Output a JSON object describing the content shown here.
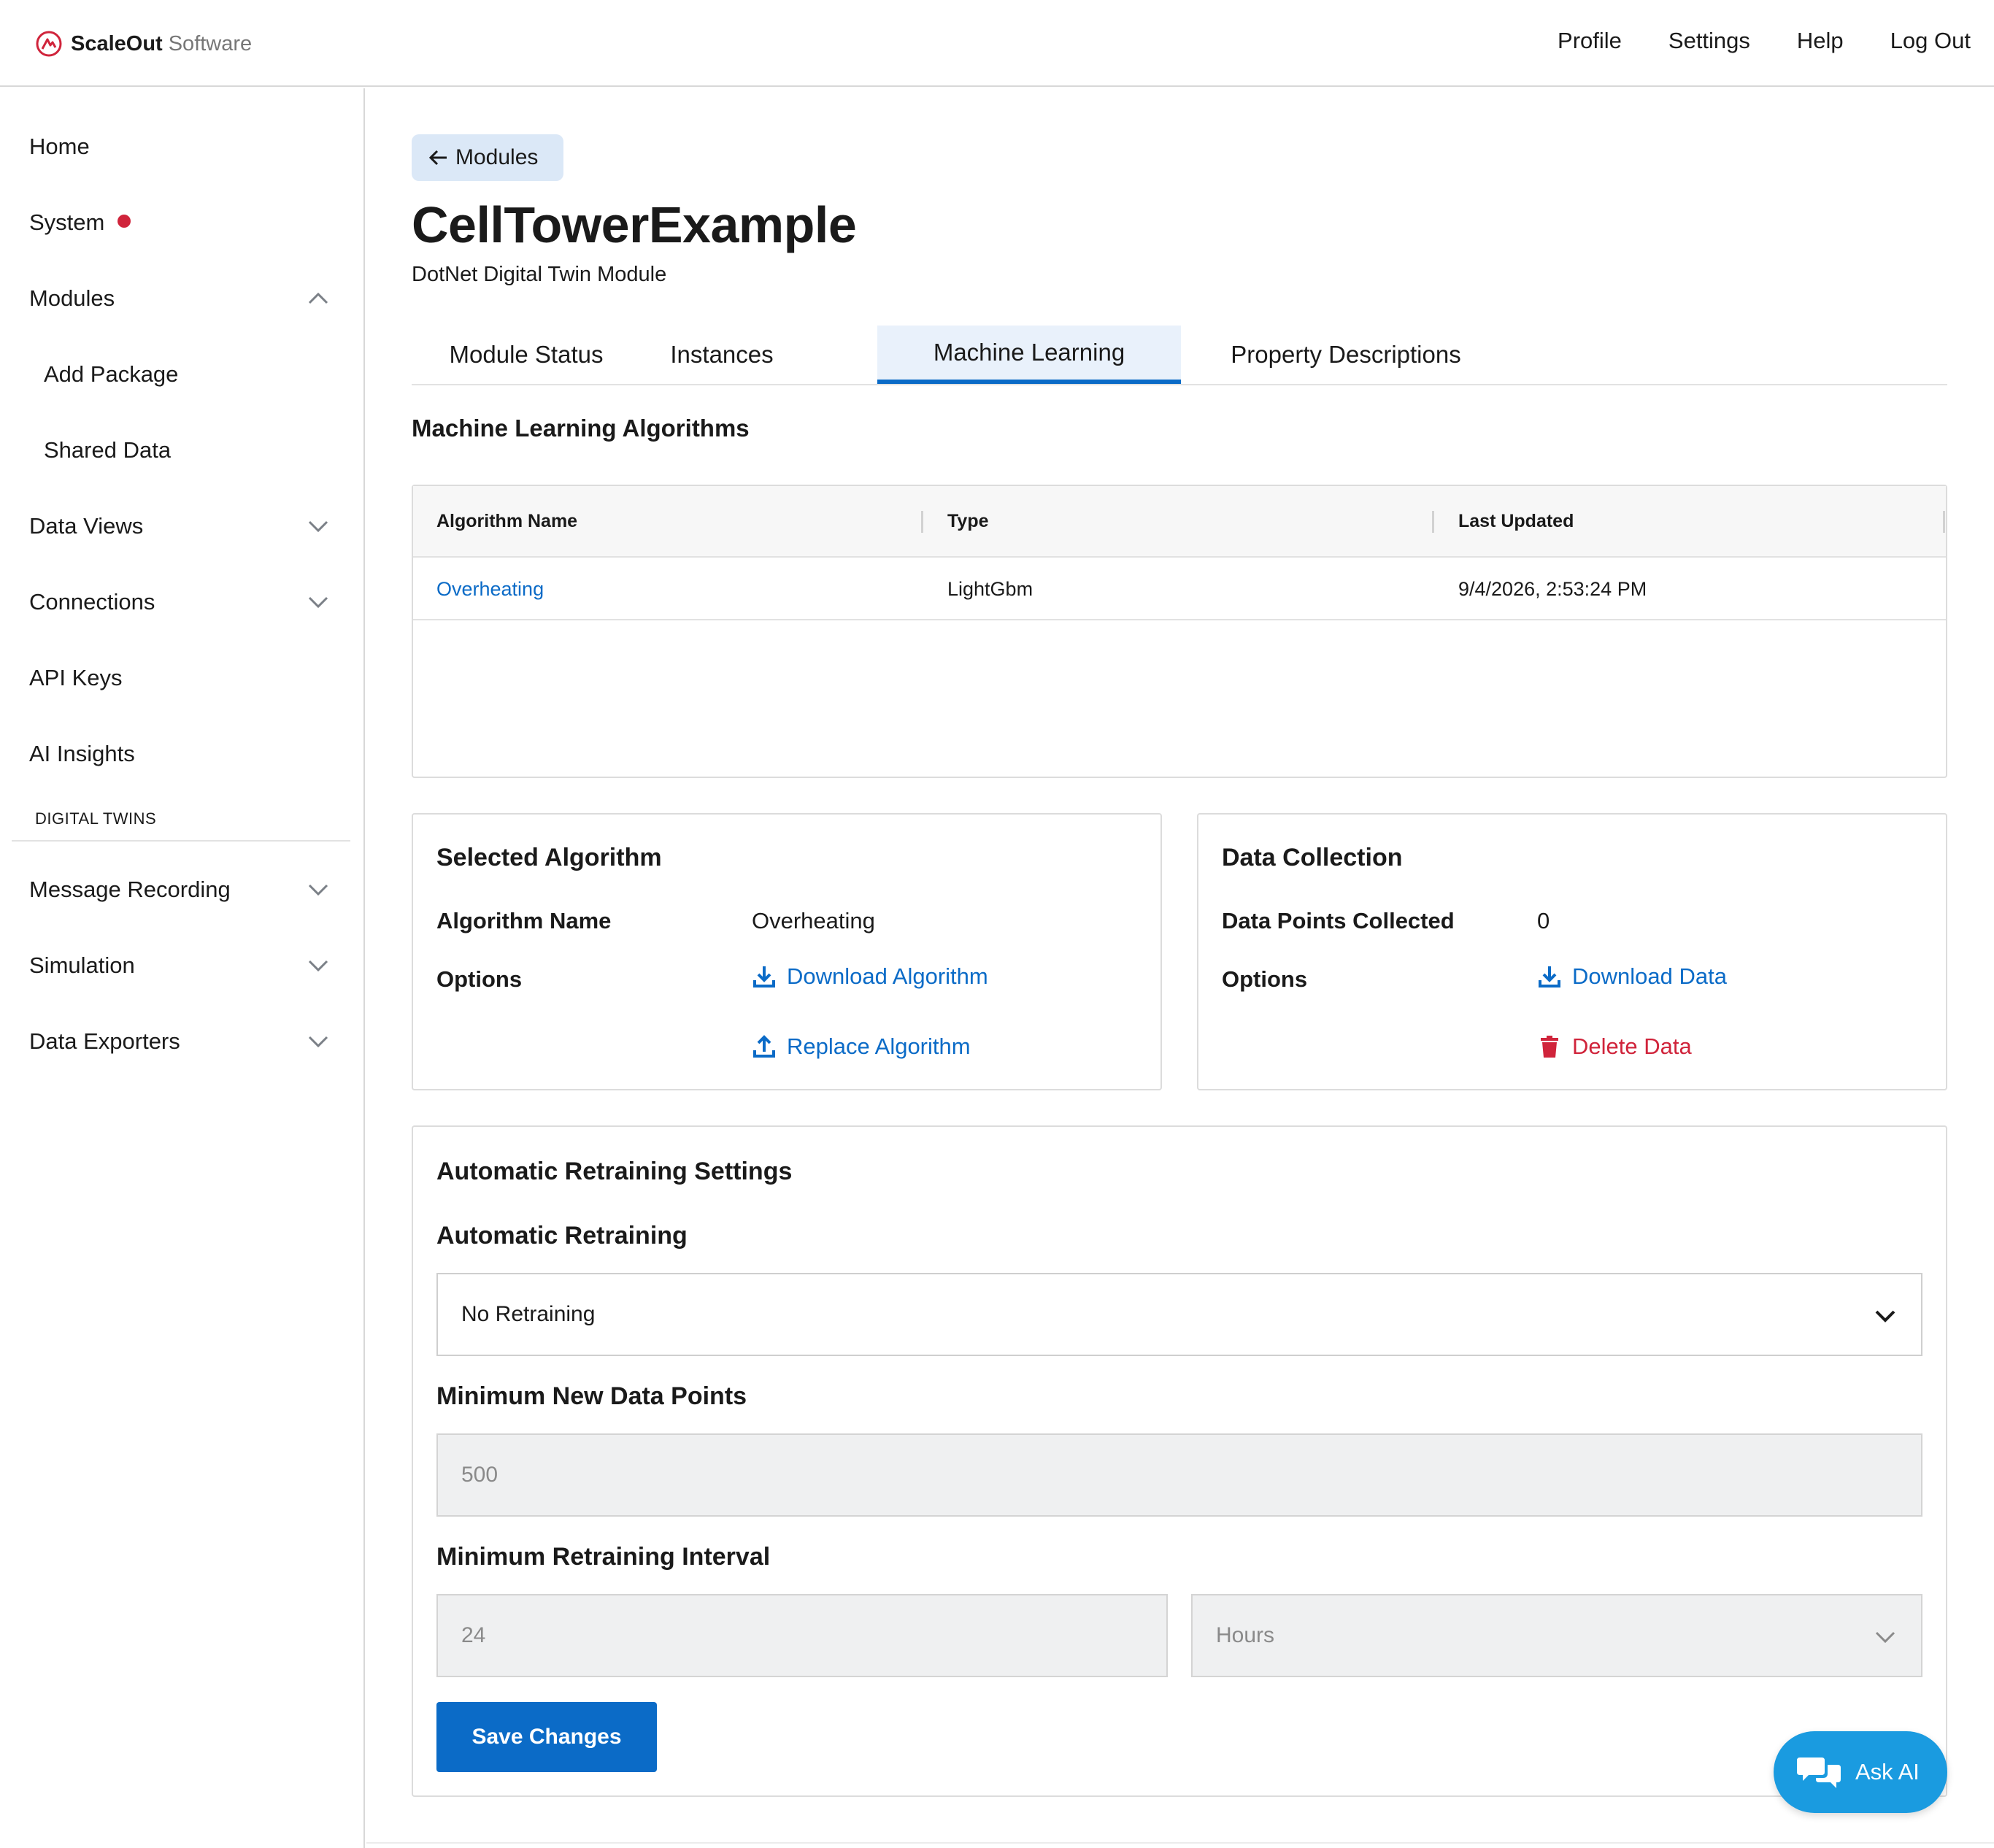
{
  "app": {
    "brand_name": "ScaleOut",
    "brand_sub": "Software"
  },
  "topnav": {
    "profile": "Profile",
    "settings": "Settings",
    "help": "Help",
    "logout": "Log Out"
  },
  "sidebar": {
    "home": "Home",
    "system": "System",
    "modules": "Modules",
    "add_package": "Add Package",
    "shared_data": "Shared Data",
    "data_views": "Data Views",
    "connections": "Connections",
    "api_keys": "API Keys",
    "ai_insights": "AI Insights",
    "section_digital_twins": "DIGITAL TWINS",
    "message_recording": "Message Recording",
    "simulation": "Simulation",
    "data_exporters": "Data Exporters",
    "system_status_color": "#d0243b"
  },
  "main": {
    "back_label": "Modules",
    "title": "CellTowerExample",
    "subtitle": "DotNet Digital Twin Module",
    "tabs": [
      {
        "label": "Module Status",
        "active": false
      },
      {
        "label": "Instances",
        "active": false
      },
      {
        "label": "Machine Learning",
        "active": true
      },
      {
        "label": "Property Descriptions",
        "active": false
      }
    ],
    "ml_section_title": "Machine Learning Algorithms",
    "table": {
      "headers": [
        "Algorithm Name",
        "Type",
        "Last Updated"
      ],
      "rows": [
        {
          "name": "Overheating",
          "type": "LightGbm",
          "updated": "9/4/2026, 2:53:24 PM"
        }
      ]
    },
    "selected_algorithm": {
      "title": "Selected Algorithm",
      "name_label": "Algorithm Name",
      "name_value": "Overheating",
      "options_label": "Options",
      "download": "Download Algorithm",
      "replace": "Replace Algorithm"
    },
    "data_collection": {
      "title": "Data Collection",
      "points_label": "Data Points Collected",
      "points_value": "0",
      "options_label": "Options",
      "download": "Download Data",
      "delete": "Delete Data"
    },
    "retraining": {
      "title": "Automatic Retraining Settings",
      "auto_label": "Automatic Retraining",
      "auto_value": "No Retraining",
      "min_points_label": "Minimum New Data Points",
      "min_points_value": "500",
      "interval_label": "Minimum Retraining Interval",
      "interval_value": "24",
      "interval_unit": "Hours",
      "save": "Save Changes"
    },
    "ask_ai": "Ask AI"
  },
  "colors": {
    "accent": "#0b6bc7",
    "danger": "#d0243b",
    "ask_ai_bg": "#1a9be0"
  }
}
